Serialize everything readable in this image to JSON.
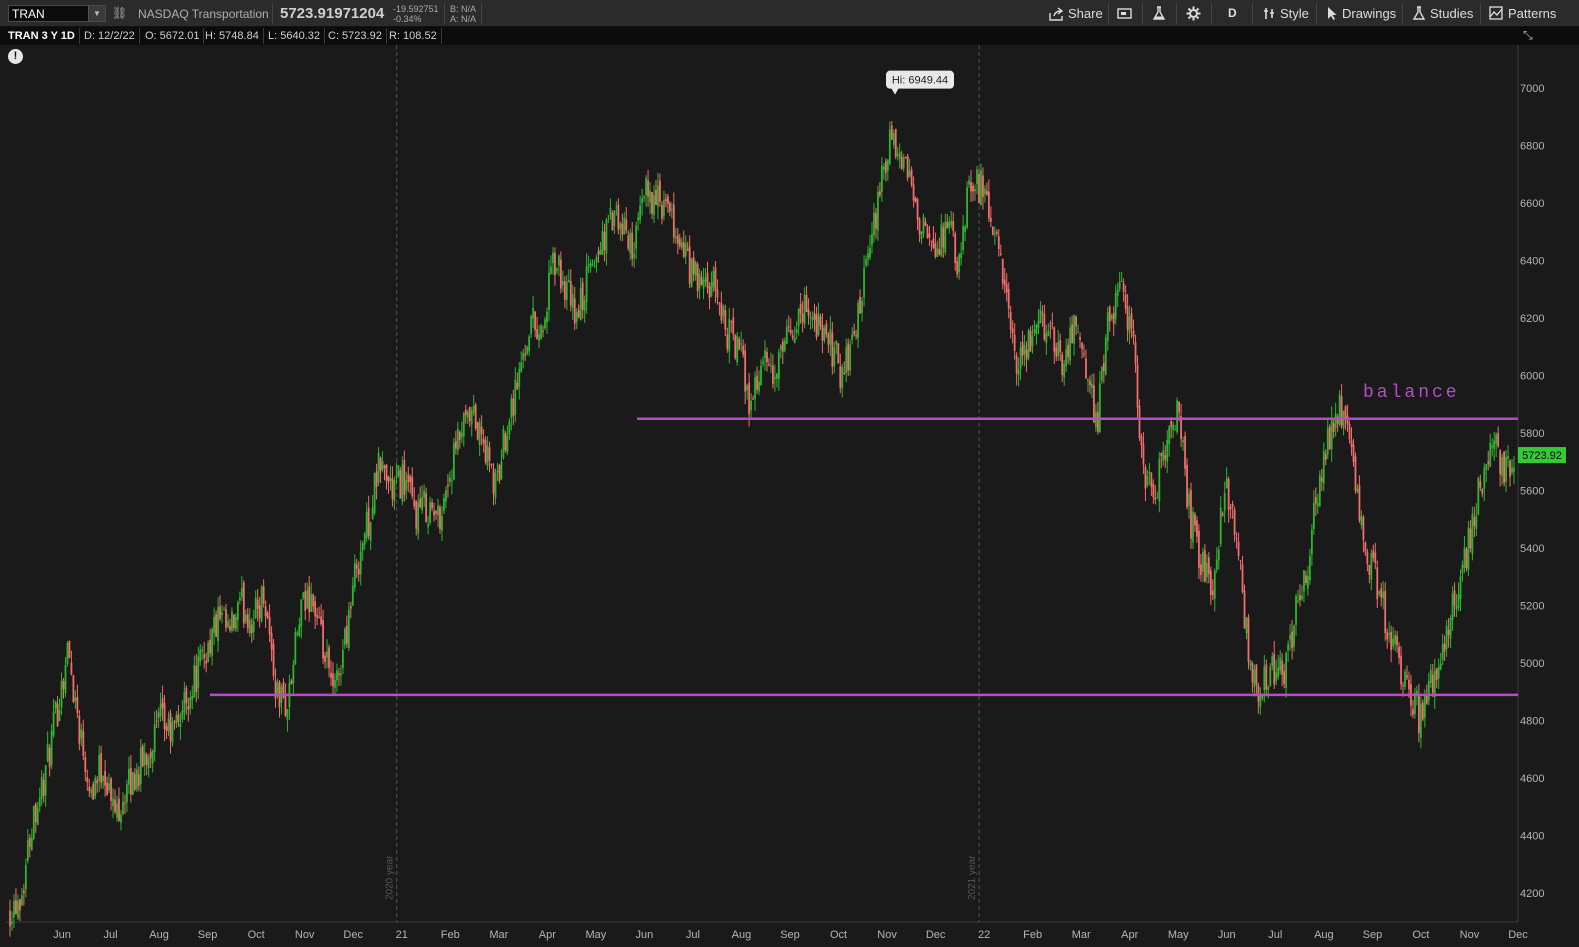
{
  "toolbar": {
    "symbol": "TRAN",
    "description": "NASDAQ Transportation",
    "last_price": "5723.91971204",
    "net_change": "-19.592751",
    "pct_change": "-0.34%",
    "bid": "B: N/A",
    "ask": "A: N/A",
    "share_label": "Share",
    "aggregation": "D",
    "style_label": "Style",
    "drawings_label": "Drawings",
    "studies_label": "Studies",
    "patterns_label": "Patterns"
  },
  "infobar": {
    "symbol_period": "TRAN 3 Y 1D",
    "date": "D: 12/2/22",
    "open": "O: 5672.01",
    "high": "H: 5748.84",
    "low": "L: 5640.32",
    "close": "C: 5723.92",
    "range": "R: 108.52"
  },
  "colors": {
    "up": "#2fb52f",
    "down": "#f26d6d",
    "drawing": "#b54dc7",
    "price_tag": "#35c935"
  },
  "chart_data": {
    "type": "candlestick",
    "ylim": [
      4100,
      7150
    ],
    "y_ticks": [
      4200,
      4400,
      4600,
      4800,
      5000,
      5200,
      5400,
      5600,
      5800,
      6000,
      6200,
      6400,
      6600,
      6800,
      7000
    ],
    "x_labels": [
      "Jun",
      "Jul",
      "Aug",
      "Sep",
      "Oct",
      "Nov",
      "Dec",
      "21",
      "Feb",
      "Mar",
      "Apr",
      "May",
      "Jun",
      "Jul",
      "Aug",
      "Sep",
      "Oct",
      "Nov",
      "Dec",
      "22",
      "Feb",
      "Mar",
      "Apr",
      "May",
      "Jun",
      "Jul",
      "Aug",
      "Sep",
      "Oct",
      "Nov",
      "Dec"
    ],
    "year_markers": [
      {
        "label": "2020 year",
        "at": "21"
      },
      {
        "label": "2021 year",
        "at": "22"
      }
    ],
    "high_label": "Hi: 6949.44",
    "high_value": 6949.44,
    "last_value_label": "5723.92",
    "last_value": 5723.92,
    "closes": [
      4150,
      4200,
      4480,
      4600,
      4820,
      5050,
      4780,
      4560,
      4650,
      4480,
      4550,
      4620,
      4700,
      4800,
      4750,
      4850,
      4950,
      5050,
      5150,
      5100,
      5200,
      5150,
      5250,
      4900,
      4850,
      5150,
      5250,
      5050,
      4880,
      5100,
      5350,
      5500,
      5700,
      5600,
      5650,
      5520,
      5550,
      5500,
      5650,
      5800,
      5850,
      5750,
      5600,
      5850,
      6000,
      6200,
      6150,
      6400,
      6300,
      6200,
      6350,
      6450,
      6550,
      6500,
      6450,
      6650,
      6600,
      6550,
      6450,
      6350,
      6300,
      6300,
      6150,
      6100,
      5900,
      6050,
      5980,
      6100,
      6200,
      6250,
      6150,
      6100,
      6000,
      6150,
      6350,
      6600,
      6800,
      6750,
      6650,
      6500,
      6400,
      6550,
      6350,
      6700,
      6650,
      6500,
      6300,
      6000,
      6100,
      6200,
      6150,
      6050,
      6200,
      6000,
      5850,
      6200,
      6300,
      6150,
      5650,
      5600,
      5750,
      5900,
      5500,
      5350,
      5250,
      5650,
      5450,
      5050,
      4900,
      5000,
      4950,
      5150,
      5300,
      5600,
      5800,
      5900,
      5700,
      5400,
      5300,
      5150,
      5000,
      4900,
      4800,
      4950,
      5100,
      5250,
      5400,
      5600,
      5800,
      5650,
      5723.92
    ],
    "annotations": [
      {
        "label": "balance",
        "value": 5850
      },
      {
        "label": "",
        "value": 4890
      }
    ]
  }
}
